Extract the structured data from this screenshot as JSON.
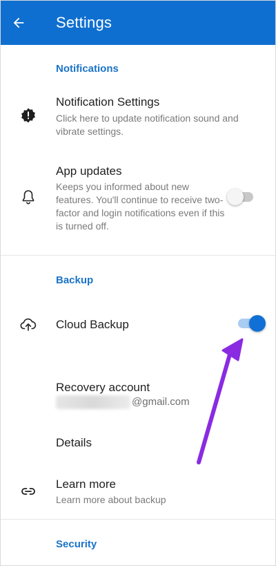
{
  "appbar": {
    "title": "Settings",
    "back_icon": "arrow-left-icon"
  },
  "sections": {
    "notifications": {
      "header": "Notifications"
    },
    "backup": {
      "header": "Backup"
    },
    "security": {
      "header": "Security"
    }
  },
  "notification_settings": {
    "title": "Notification Settings",
    "subtitle": "Click here to update notification sound and vibrate settings.",
    "icon": "alert-badge-icon"
  },
  "app_updates": {
    "title": "App updates",
    "subtitle": "Keeps you informed about new features. You'll continue to receive two-factor and login notifications even if this is turned off.",
    "icon": "bell-icon",
    "toggle_on": false
  },
  "cloud_backup": {
    "title": "Cloud Backup",
    "icon": "cloud-upload-icon",
    "toggle_on": true
  },
  "recovery_account": {
    "title": "Recovery account",
    "email_suffix": "@gmail.com"
  },
  "details": {
    "title": "Details"
  },
  "learn_more": {
    "title": "Learn more",
    "subtitle": "Learn more about backup",
    "icon": "link-icon"
  },
  "colors": {
    "appbar": "#0f6fd0",
    "accent": "#1a73c8",
    "toggle_on": "#1170d6",
    "annotation_arrow": "#8a2be2"
  }
}
